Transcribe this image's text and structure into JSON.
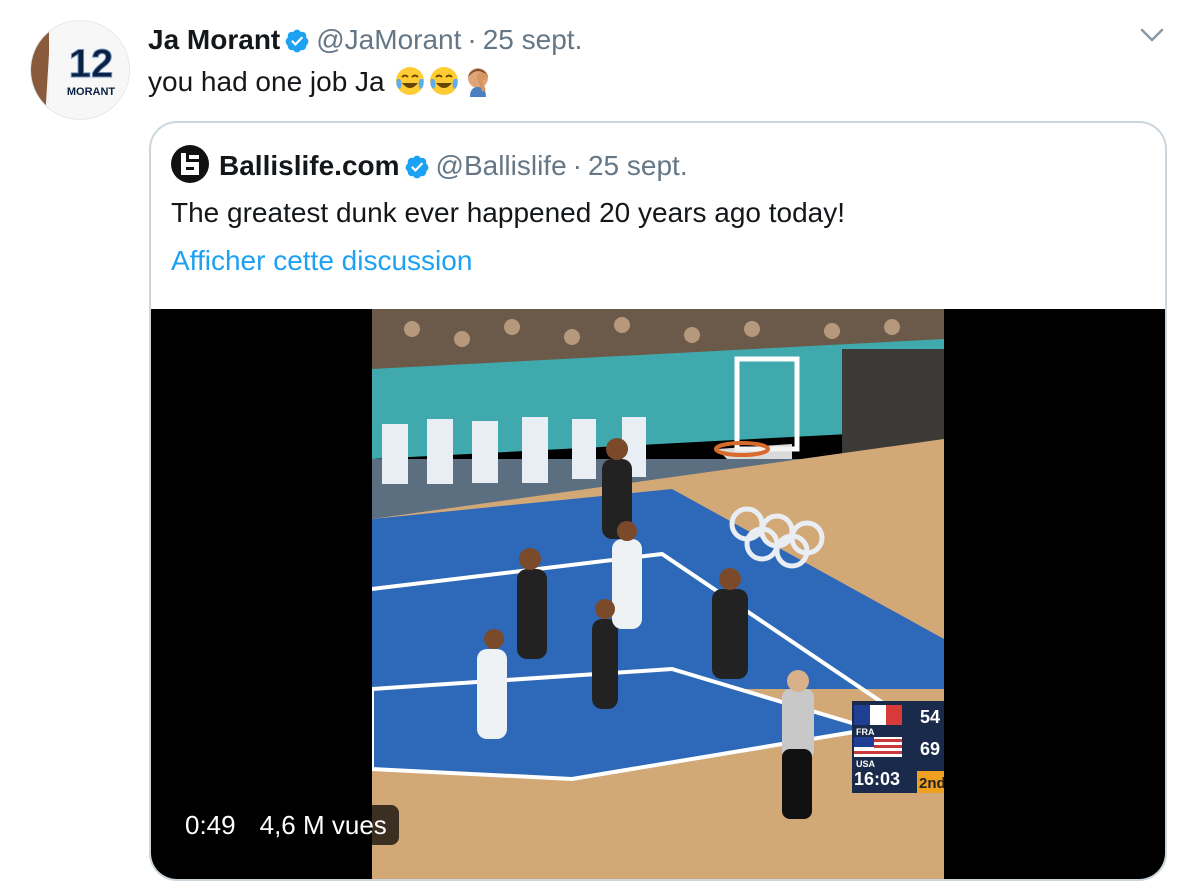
{
  "tweet": {
    "author_name": "Ja Morant",
    "author_handle": "@JaMorant",
    "separator": "·",
    "date": "25 sept.",
    "avatar_jersey_number": "12",
    "avatar_jersey_name": "MORANT",
    "text": "you had one job Ja",
    "emojis": [
      "face-with-tears-of-joy",
      "face-with-tears-of-joy",
      "man-facepalming"
    ]
  },
  "quoted_tweet": {
    "author_name": "Ballislife.com",
    "author_handle": "@Ballislife",
    "separator": "·",
    "date": "25 sept.",
    "text": "The greatest dunk ever happened 20 years ago today!",
    "show_thread_label": "Afficher cette discussion",
    "video": {
      "duration": "0:49",
      "views": "4,6 M vues",
      "scoreboard": {
        "team1": "FRA",
        "score1": "54",
        "team2": "USA",
        "score2": "69",
        "clock": "16:03",
        "period": "2nd"
      }
    }
  },
  "colors": {
    "text_primary": "#14171a",
    "text_secondary": "#657786",
    "link": "#1da1f2",
    "verified": "#1da1f2",
    "border": "#ccd6dd"
  },
  "icons": [
    "verified-badge-icon",
    "chevron-down-icon",
    "ballislife-logo-icon"
  ]
}
